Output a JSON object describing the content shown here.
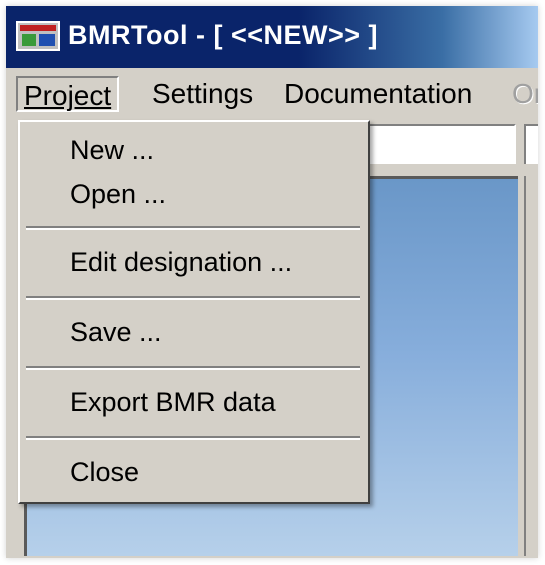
{
  "window": {
    "title": "BMRTool  - [ <<NEW>> ]",
    "app_icon": "bmrtool-app-icon"
  },
  "menubar": {
    "items": [
      {
        "label": "Project",
        "state": "open"
      },
      {
        "label": "Settings",
        "state": "normal"
      },
      {
        "label": "Documentation",
        "state": "normal"
      },
      {
        "label": "Or",
        "state": "disabled"
      }
    ]
  },
  "project_menu": {
    "items": [
      {
        "label": "New ..."
      },
      {
        "label": "Open ..."
      },
      {
        "label": "Edit designation ..."
      },
      {
        "label": "Save ..."
      },
      {
        "label": "Export BMR data"
      },
      {
        "label": "Close"
      }
    ]
  },
  "colors": {
    "titlebar_start": "#0a246a",
    "titlebar_end": "#a6caf0",
    "menu_face": "#d4d0c8",
    "content_blue": "#6a97c8"
  }
}
